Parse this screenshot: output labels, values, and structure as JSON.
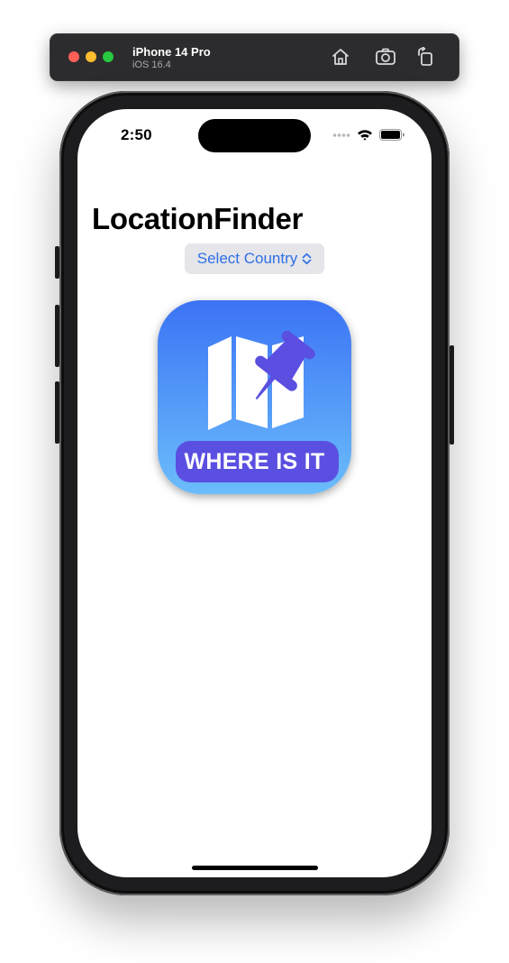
{
  "simulator": {
    "device_name": "iPhone 14 Pro",
    "os_version": "iOS 16.4",
    "toolbar_icons": [
      "home-icon",
      "screenshot-icon",
      "rotate-icon"
    ]
  },
  "status_bar": {
    "time": "2:50",
    "icons": [
      "cellular-dots-icon",
      "wifi-icon",
      "battery-icon"
    ]
  },
  "app": {
    "title": "LocationFinder",
    "picker": {
      "label": "Select Country",
      "icon": "chevron-up-down-icon"
    },
    "icon_banner": "WHERE IS IT"
  },
  "colors": {
    "accent": "#2f6fe4",
    "icon_gradient_top": "#3b73f5",
    "icon_gradient_bottom": "#6bbdfb",
    "banner": "#5a4fe0",
    "pin": "#5a4fe0"
  }
}
